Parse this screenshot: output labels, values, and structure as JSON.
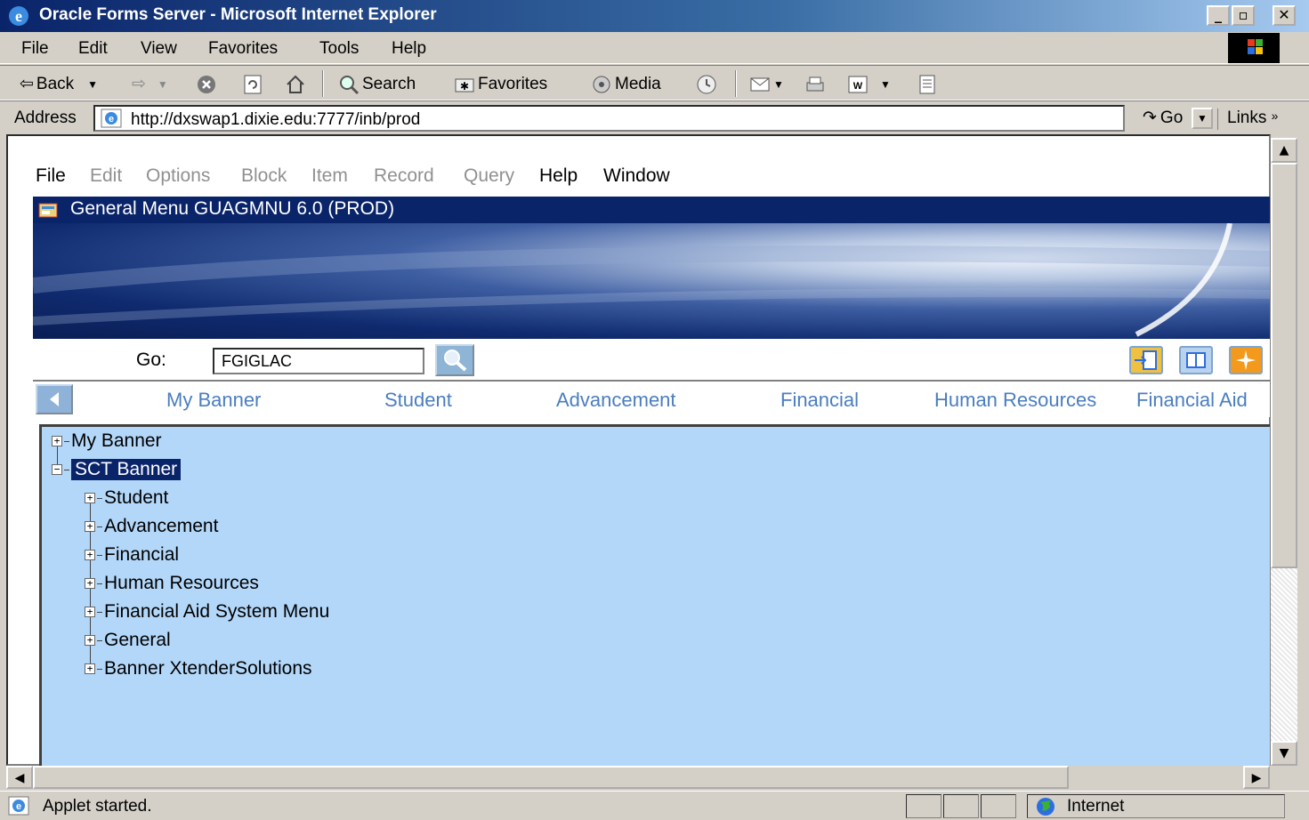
{
  "window": {
    "title": "Oracle Forms Server - Microsoft Internet Explorer",
    "min_label": "_",
    "max_label": "▫",
    "close_label": "✕"
  },
  "menubar": [
    "File",
    "Edit",
    "View",
    "Favorites",
    "Tools",
    "Help"
  ],
  "toolbar": {
    "back": "Back",
    "search": "Search",
    "favorites": "Favorites",
    "media": "Media"
  },
  "address": {
    "label": "Address",
    "url": "http://dxswap1.dixie.edu:7777/inb/prod",
    "go": "Go",
    "links": "Links"
  },
  "forms_menu": [
    {
      "label": "File",
      "enabled": true
    },
    {
      "label": "Edit",
      "enabled": false
    },
    {
      "label": "Options",
      "enabled": false
    },
    {
      "label": "Block",
      "enabled": false
    },
    {
      "label": "Item",
      "enabled": false
    },
    {
      "label": "Record",
      "enabled": false
    },
    {
      "label": "Query",
      "enabled": false
    },
    {
      "label": "Help",
      "enabled": true
    },
    {
      "label": "Window",
      "enabled": true
    }
  ],
  "form": {
    "title": "General Menu  GUAGMNU  6.0  (PROD)",
    "go_label": "Go:",
    "go_value": "FGIGLAC"
  },
  "tabs": [
    "My Banner",
    "Student",
    "Advancement",
    "Financial",
    "Human Resources",
    "Financial Aid"
  ],
  "tree": {
    "root1": "My Banner",
    "root2": "SCT Banner",
    "children": [
      "Student",
      "Advancement",
      "Financial",
      "Human Resources",
      "Financial Aid System Menu",
      "General",
      "Banner XtenderSolutions"
    ]
  },
  "status": {
    "text": "Applet started.",
    "zone": "Internet"
  },
  "colors": {
    "title_bar": "#0a246a",
    "tree_bg": "#b3d7f9",
    "tab_text": "#4a7ebf"
  }
}
